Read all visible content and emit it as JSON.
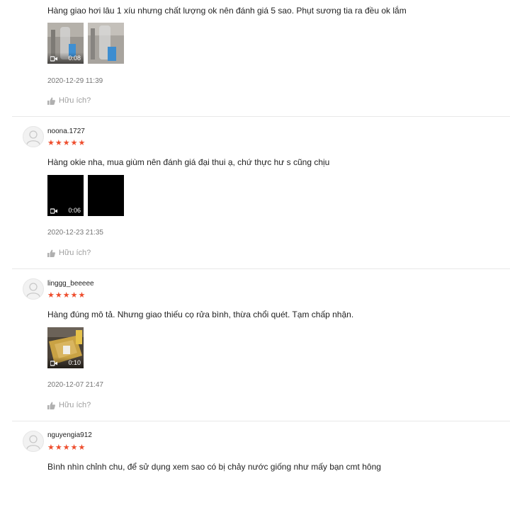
{
  "reviews": [
    {
      "username": "",
      "stars": "★★★★★",
      "comment": "Hàng giao hơi lâu 1 xíu nhưng chất lượng ok nên đánh giá 5 sao. Phụt sương tia ra đều ok lắm",
      "media": [
        {
          "kind": "video",
          "duration": "0:08",
          "scene": "bottle-gray"
        },
        {
          "kind": "image",
          "scene": "bottle-gray"
        }
      ],
      "date": "2020-12-29 11:39",
      "helpful_label": "Hữu ích?"
    },
    {
      "username": "noona.1727",
      "stars": "★★★★★",
      "comment": "Hàng okie nha, mua giùm nên đánh giá đại thui ạ, chứ thực hư s cũng chịu",
      "media": [
        {
          "kind": "video",
          "duration": "0:06",
          "scene": "black"
        },
        {
          "kind": "image",
          "scene": "black"
        }
      ],
      "date": "2020-12-23 21:35",
      "helpful_label": "Hữu ích?"
    },
    {
      "username": "linggg_beeeee",
      "stars": "★★★★★",
      "comment": "Hàng đúng mô tả. Nhưng giao thiếu cọ rửa bình, thừa chổi quét. Tạm chấp nhận.",
      "media": [
        {
          "kind": "video",
          "duration": "0:10",
          "scene": "yellow-box"
        }
      ],
      "date": "2020-12-07 21:47",
      "helpful_label": "Hữu ích?"
    },
    {
      "username": "nguyengia912",
      "stars": "★★★★★",
      "comment": "Bình nhìn chỉnh chu, để sử dụng xem sao có bị chảy nước giống như mấy bạn cmt hông",
      "media": [
        {
          "kind": "image",
          "scene": "brown"
        },
        {
          "kind": "image",
          "scene": "brown"
        }
      ],
      "date": "",
      "helpful_label": ""
    }
  ],
  "colors": {
    "star": "#ee4d2d",
    "date": "#757575",
    "helpful": "#9e9e9e",
    "divider": "#e8e8e8"
  },
  "icons": {
    "avatar": "default-user-icon",
    "video": "video-camera-icon",
    "helpful": "thumbs-up-icon"
  }
}
